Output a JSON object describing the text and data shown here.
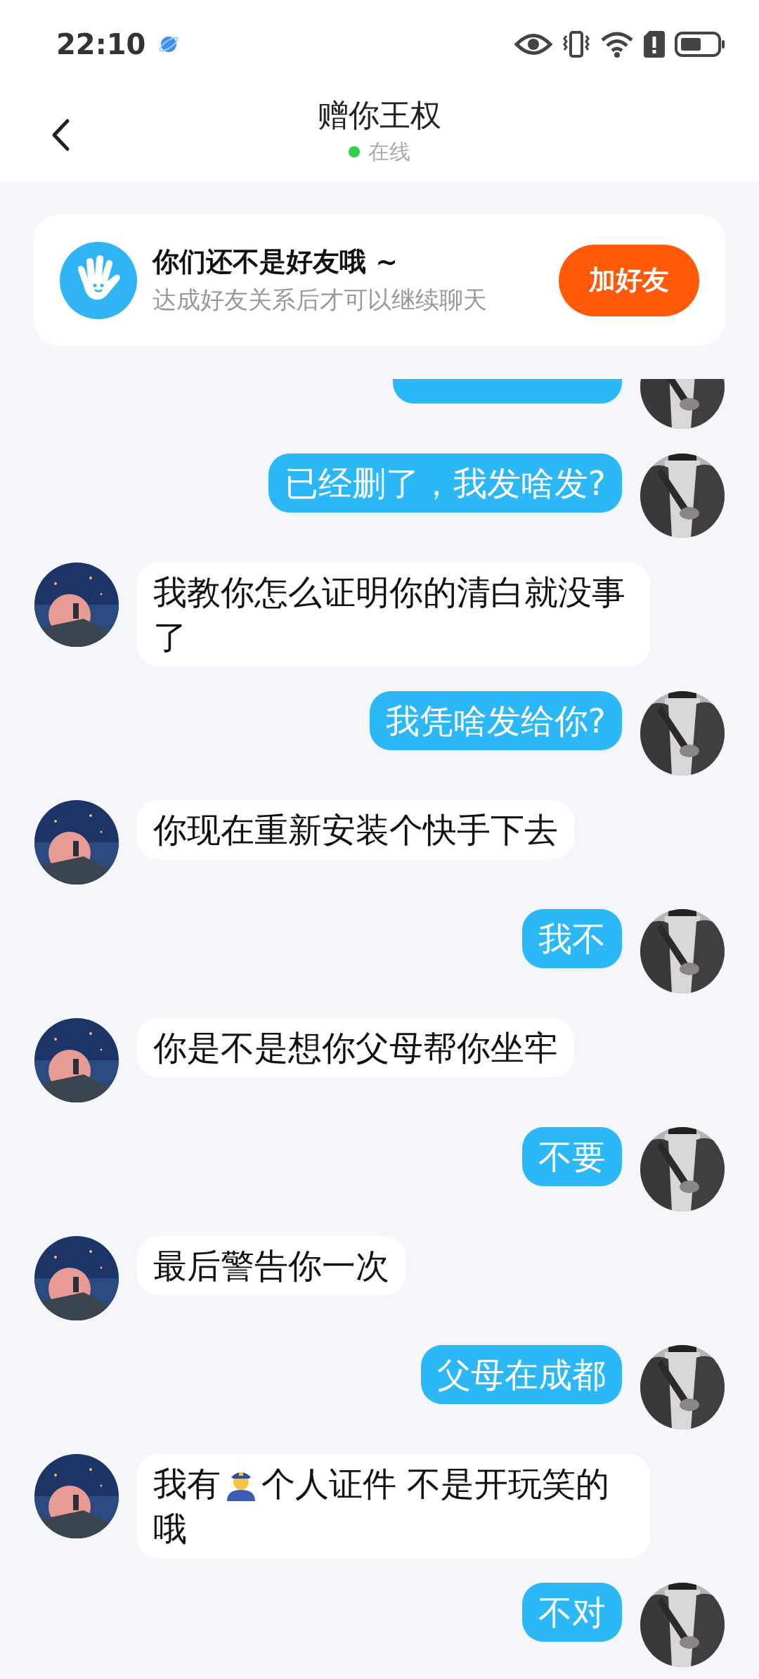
{
  "status_bar": {
    "time": "22:10"
  },
  "header": {
    "title": "赠你王权",
    "status": "在线",
    "online": true
  },
  "friend_banner": {
    "title": "你们还不是好友哦 ~",
    "subtitle": "达成好友关系后才可以继续聊天",
    "button": "加好友"
  },
  "messages": [
    {
      "kind": "sent"
    },
    {
      "kind": "sent",
      "segments": [
        {
          "kind": "text",
          "text": "已经删了，我发啥发?"
        }
      ]
    },
    {
      "kind": "received",
      "segments": [
        {
          "kind": "text",
          "text": "我教你怎么证明你的清白就没事了"
        }
      ]
    },
    {
      "kind": "sent",
      "segments": [
        {
          "kind": "text",
          "text": "我凭啥发给你?"
        }
      ]
    },
    {
      "kind": "received",
      "segments": [
        {
          "kind": "text",
          "text": "你现在重新安装个快手下去"
        }
      ]
    },
    {
      "kind": "sent",
      "segments": [
        {
          "kind": "text",
          "text": "我不"
        }
      ]
    },
    {
      "kind": "received",
      "segments": [
        {
          "kind": "text",
          "text": "你是不是想你父母帮你坐牢"
        }
      ]
    },
    {
      "kind": "sent",
      "segments": [
        {
          "kind": "text",
          "text": "不要"
        }
      ]
    },
    {
      "kind": "received",
      "segments": [
        {
          "kind": "text",
          "text": "最后警告你一次"
        }
      ]
    },
    {
      "kind": "sent",
      "segments": [
        {
          "kind": "text",
          "text": "父母在成都"
        }
      ]
    },
    {
      "kind": "received",
      "segments": [
        {
          "kind": "text",
          "text": "我有"
        },
        {
          "kind": "emoji"
        },
        {
          "kind": "text",
          "text": "个人证件 不是开玩笑的哦"
        }
      ]
    },
    {
      "kind": "sent",
      "segments": [
        {
          "kind": "text",
          "text": "不对"
        }
      ]
    }
  ]
}
